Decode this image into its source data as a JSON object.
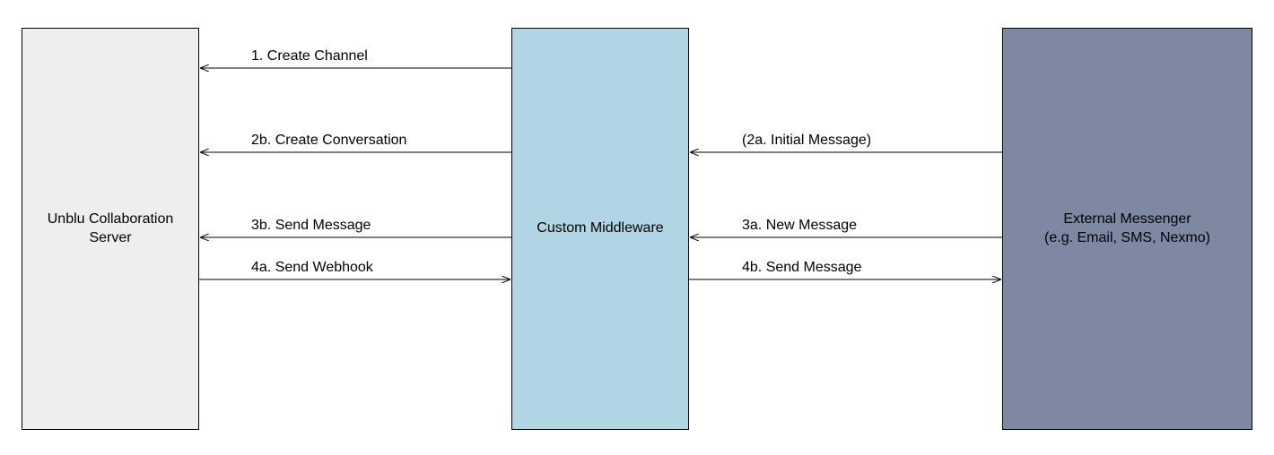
{
  "boxes": {
    "left": "Unblu Collaboration\nServer",
    "mid": "Custom Middleware",
    "right": "External Messenger\n(e.g. Email, SMS, Nexmo)"
  },
  "arrows": {
    "a1": "1. Create Channel",
    "a2b": "2b. Create Conversation",
    "a3b": "3b. Send Message",
    "a4a": "4a. Send Webhook",
    "a2a": "(2a. Initial Message)",
    "a3a": "3a. New Message",
    "a4b": "4b. Send Message"
  }
}
